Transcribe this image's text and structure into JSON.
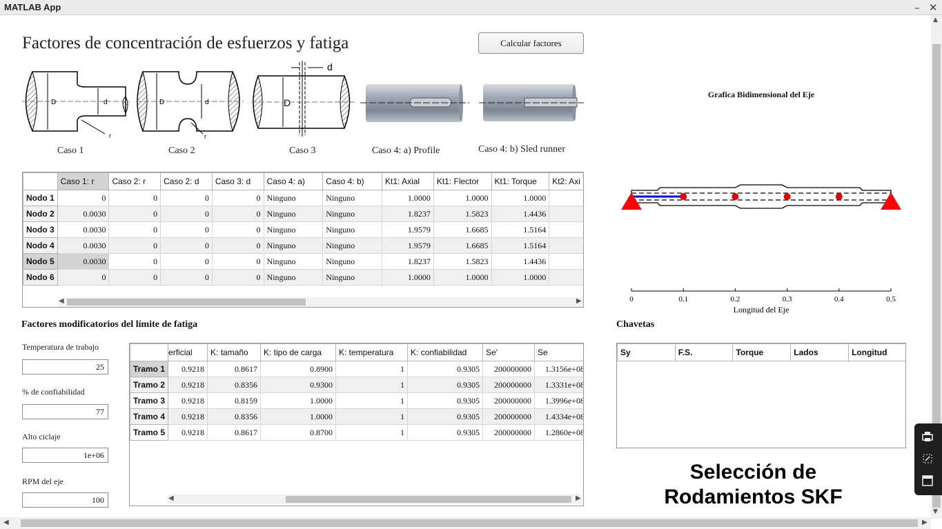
{
  "window": {
    "title": "MATLAB App",
    "minimize": "–",
    "close": "✕"
  },
  "main_title": "Factores de concentración de esfuerzos y fatiga",
  "calc_button": "Calcular factores",
  "casos": [
    {
      "label": "Caso 1",
      "dims": [
        "D",
        "d",
        "r"
      ]
    },
    {
      "label": "Caso 2",
      "dims": [
        "D",
        "d",
        "r"
      ]
    },
    {
      "label": "Caso 3",
      "dims": [
        "d",
        "D"
      ]
    },
    {
      "label": "Caso 4: a) Profile"
    },
    {
      "label": "Caso 4: b) Sled runner"
    }
  ],
  "table1": {
    "headers": [
      "Caso 1: r",
      "Caso 2: r",
      "Caso 2: d",
      "Caso 3: d",
      "Caso 4: a)",
      "Caso 4: b)",
      "Kt1: Axial",
      "Kt1: Flector",
      "Kt1: Torque",
      "Kt2: Axi"
    ],
    "rows": [
      {
        "name": "Nodo 1",
        "cells": [
          "0",
          "0",
          "0",
          "0",
          "Ninguno",
          "Ninguno",
          "1.0000",
          "1.0000",
          "1.0000",
          ""
        ]
      },
      {
        "name": "Nodo 2",
        "cells": [
          "0.0030",
          "0",
          "0",
          "0",
          "Ninguno",
          "Ninguno",
          "1.8237",
          "1.5823",
          "1.4436",
          ""
        ]
      },
      {
        "name": "Nodo 3",
        "cells": [
          "0.0030",
          "0",
          "0",
          "0",
          "Ninguno",
          "Ninguno",
          "1.9579",
          "1.6685",
          "1.5164",
          ""
        ]
      },
      {
        "name": "Nodo 4",
        "cells": [
          "0.0030",
          "0",
          "0",
          "0",
          "Ninguno",
          "Ninguno",
          "1.9579",
          "1.6685",
          "1.5164",
          ""
        ]
      },
      {
        "name": "Nodo 5",
        "cells": [
          "0.0030",
          "0",
          "0",
          "0",
          "Ninguno",
          "Ninguno",
          "1.8237",
          "1.5823",
          "1.4436",
          ""
        ]
      },
      {
        "name": "Nodo 6",
        "cells": [
          "0",
          "0",
          "0",
          "0",
          "Ninguno",
          "Ninguno",
          "1.0000",
          "1.0000",
          "1.0000",
          ""
        ]
      }
    ]
  },
  "shaft_chart": {
    "title": "Grafica Bidimensional del Eje",
    "xlabel": "Longitud del Eje",
    "xticks": [
      "0",
      "0.1",
      "0.2",
      "0.3",
      "0.4",
      "0.5"
    ],
    "xlim": [
      0,
      0.5
    ],
    "nodes_x": [
      0.1,
      0.2,
      0.3,
      0.4
    ],
    "supports_x": [
      0,
      0.5
    ],
    "highlight_segment": [
      0,
      0.1
    ],
    "colors": {
      "support": "#ff0000",
      "node": "#e00000",
      "highlight": "#0000ff",
      "outline": "#000000"
    }
  },
  "fatigue": {
    "title": "Factores modificatorios del límite de fatiga",
    "fields": [
      {
        "label": "Temperatura de trabajo",
        "value": "25"
      },
      {
        "label": "% de confiabilidad",
        "value": "77"
      },
      {
        "label": "Alto ciclaje",
        "value": "1e+06"
      },
      {
        "label": "RPM del eje",
        "value": "100"
      }
    ],
    "headers": [
      "erficial",
      "K: tamaño",
      "K: tipo de carga",
      "K: temperatura",
      "K: confiabilidad",
      "Se'",
      "Se"
    ],
    "rows": [
      {
        "name": "Tramo 1",
        "cells": [
          "0.9218",
          "0.8617",
          "0.8900",
          "1",
          "0.9305",
          "200000000",
          "1.3156e+08"
        ]
      },
      {
        "name": "Tramo 2",
        "cells": [
          "0.9218",
          "0.8356",
          "0.9300",
          "1",
          "0.9305",
          "200000000",
          "1.3331e+08"
        ]
      },
      {
        "name": "Tramo 3",
        "cells": [
          "0.9218",
          "0.8159",
          "1.0000",
          "1",
          "0.9305",
          "200000000",
          "1.3996e+08"
        ]
      },
      {
        "name": "Tramo 4",
        "cells": [
          "0.9218",
          "0.8356",
          "1.0000",
          "1",
          "0.9305",
          "200000000",
          "1.4334e+08"
        ]
      },
      {
        "name": "Tramo 5",
        "cells": [
          "0.9218",
          "0.8617",
          "0.8700",
          "1",
          "0.9305",
          "200000000",
          "1.2860e+08"
        ]
      }
    ]
  },
  "chavetas": {
    "title": "Chavetas",
    "headers": [
      "Sy",
      "F.S.",
      "Torque",
      "Lados",
      "Longitud"
    ]
  },
  "skf_heading": [
    "Selección de",
    "Rodamientos SKF"
  ]
}
